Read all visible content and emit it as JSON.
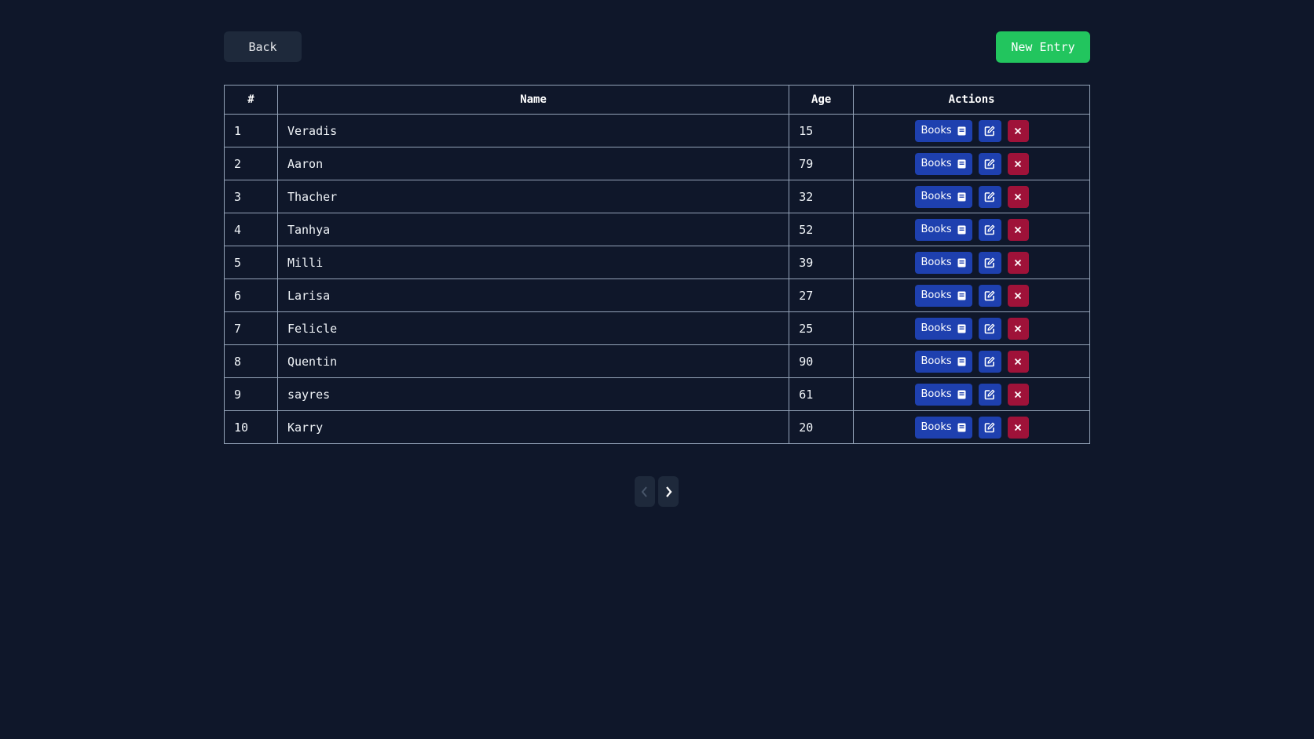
{
  "header": {
    "back_label": "Back",
    "new_entry_label": "New Entry"
  },
  "table": {
    "columns": [
      "#",
      "Name",
      "Age",
      "Actions"
    ],
    "rows": [
      {
        "num": "1",
        "name": "Veradis",
        "age": "15"
      },
      {
        "num": "2",
        "name": "Aaron",
        "age": "79"
      },
      {
        "num": "3",
        "name": "Thacher",
        "age": "32"
      },
      {
        "num": "4",
        "name": "Tanhya",
        "age": "52"
      },
      {
        "num": "5",
        "name": "Milli",
        "age": "39"
      },
      {
        "num": "6",
        "name": "Larisa",
        "age": "27"
      },
      {
        "num": "7",
        "name": "Felicle",
        "age": "25"
      },
      {
        "num": "8",
        "name": "Quentin",
        "age": "90"
      },
      {
        "num": "9",
        "name": "sayres",
        "age": "61"
      },
      {
        "num": "10",
        "name": "Karry",
        "age": "20"
      }
    ],
    "actions": {
      "books_label": "Books",
      "books_icon": "book-icon",
      "edit_icon": "edit-icon",
      "delete_icon": "close-icon"
    }
  },
  "pagination": {
    "prev_icon": "chevron-left-icon",
    "next_icon": "chevron-right-icon"
  },
  "colors": {
    "background": "#0f172a",
    "button_dark": "#1e293b",
    "accent_green": "#22c55e",
    "action_blue": "#1e40af",
    "action_red": "#9f1239"
  }
}
